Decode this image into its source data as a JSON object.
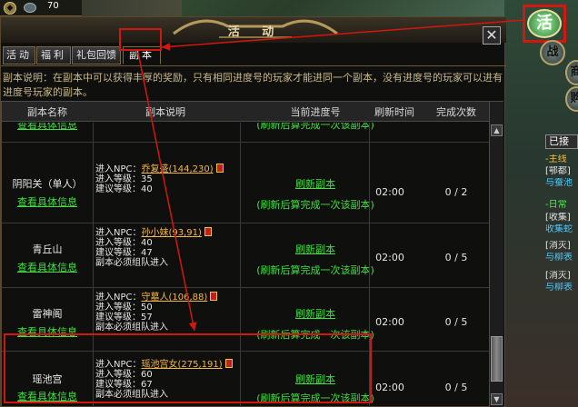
{
  "hud": {
    "level": "70"
  },
  "dialog": {
    "title": "活 动",
    "close": "✕",
    "tabs": [
      {
        "label": "活动"
      },
      {
        "label": "福利"
      },
      {
        "label": "礼包回馈"
      },
      {
        "label": "副本"
      }
    ],
    "description": "副本说明：在副本中可以获得丰厚的奖励，只有相同进度号的玩家才能进同一个副本，没有进度号的玩家可以进有进度号玩家的副本。"
  },
  "table": {
    "headers": [
      "副本名称",
      "副本说明",
      "当前进度号",
      "刷新时间",
      "完成次数"
    ],
    "top_partial": {
      "name": "查看具体信息",
      "note": "(刷新后算完成一次该副本)"
    },
    "rows": [
      {
        "name": "阴阳关（单人）",
        "view": "查看具体信息",
        "npc_prefix": "进入NPC：",
        "npc": "乔复盛(144,230)",
        "lines": [
          "进入等级：35",
          "建议等级：40"
        ],
        "refresh": "刷新副本",
        "note": "(刷新后算完成一次该副本)",
        "time": "02:00",
        "count": "0 / 2"
      },
      {
        "name": "青丘山",
        "view": "查看具体信息",
        "npc_prefix": "进入NPC：",
        "npc": "孙小妹(93,91)",
        "lines": [
          "进入等级：40",
          "建议等级：47",
          "副本必须组队进入"
        ],
        "refresh": "刷新副本",
        "note": "(刷新后算完成一次该副本)",
        "time": "02:00",
        "count": "0 / 5"
      },
      {
        "name": "雷神阁",
        "view": "查看具体信息",
        "npc_prefix": "进入NPC：",
        "npc": "守墓人(106,88)",
        "lines": [
          "进入等级：50",
          "建议等级：57",
          "副本必须组队进入"
        ],
        "refresh": "刷新副本",
        "note": "(刷新后算完成一次该副本)",
        "time": "02:00",
        "count": "0 / 5"
      },
      {
        "name": "瑶池宫",
        "view": "查看具体信息",
        "npc_prefix": "进入NPC：",
        "npc": "瑶池宫女(275,191)",
        "lines": [
          "进入等级：60",
          "建议等级：67",
          "副本必须组队进入"
        ],
        "refresh": "刷新副本",
        "note": "(刷新后算完成一次该副本)",
        "time": "02:00",
        "count": "0 / 5"
      }
    ]
  },
  "side": {
    "huo": "活",
    "btn2": "战",
    "btn3": "商",
    "btn4": "购",
    "accepted": "已接",
    "quests": [
      {
        "text": "-主线",
        "color": "gold"
      },
      {
        "text": "[鄂都]",
        "color": "white"
      },
      {
        "text": "与蚕池",
        "color": "blue"
      },
      {
        "text": "-日常",
        "color": "gold"
      },
      {
        "text": "[收集]",
        "color": "white"
      },
      {
        "text": "收集蛇",
        "color": "blue"
      },
      {
        "text": "[消灭]",
        "color": "white"
      },
      {
        "text": "与柳表",
        "color": "blue"
      },
      {
        "text": "[消灭]",
        "color": "white"
      },
      {
        "text": "与柳表",
        "color": "blue"
      }
    ]
  }
}
